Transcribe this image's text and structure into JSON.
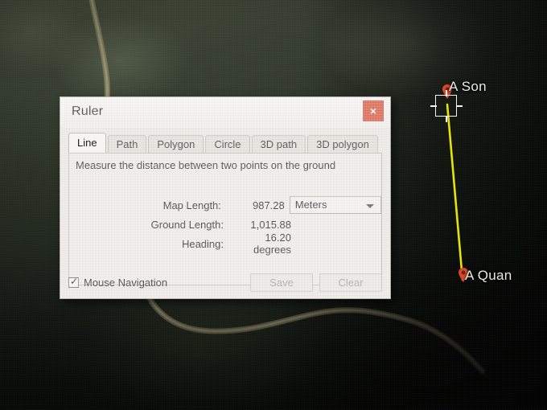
{
  "map": {
    "placemarks": [
      {
        "name": "A Son",
        "label": "A Son",
        "selected": true
      },
      {
        "name": "A Quan",
        "label": "A Quan",
        "selected": false
      }
    ],
    "line_color": "#e8e400",
    "pin_color": "#d8492c"
  },
  "dialog": {
    "title": "Ruler",
    "close_label": "×",
    "tabs": [
      {
        "label": "Line",
        "active": true
      },
      {
        "label": "Path",
        "active": false
      },
      {
        "label": "Polygon",
        "active": false
      },
      {
        "label": "Circle",
        "active": false
      },
      {
        "label": "3D path",
        "active": false
      },
      {
        "label": "3D polygon",
        "active": false
      }
    ],
    "description": "Measure the distance between two points on the ground",
    "fields": [
      {
        "label": "Map Length:",
        "value": "987.28",
        "unit": "Meters"
      },
      {
        "label": "Ground Length:",
        "value": "1,015.88",
        "unit": ""
      },
      {
        "label": "Heading:",
        "value": "16.20 degrees",
        "unit": ""
      }
    ],
    "unit_selected": "Meters",
    "mouse_navigation_label": "Mouse Navigation",
    "mouse_navigation_checked": true,
    "save_label": "Save",
    "clear_label": "Clear",
    "accent_close": "#de5740"
  }
}
